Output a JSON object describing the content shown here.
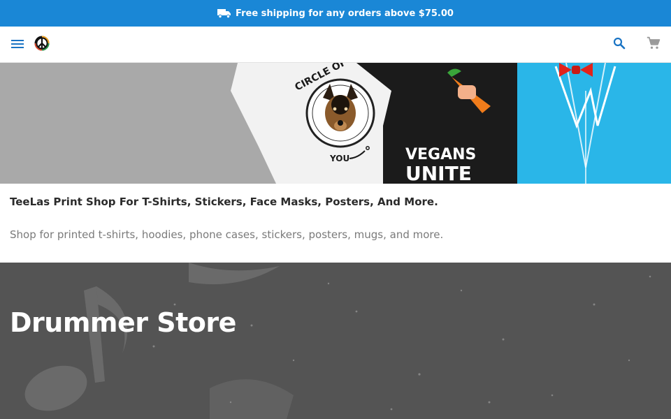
{
  "promo": {
    "text": "Free shipping for any orders above $75.00",
    "icon": "truck-icon"
  },
  "header": {
    "menu_icon": "menu-icon",
    "logo_icon": "peace-sign-logo",
    "search_icon": "search-icon",
    "cart_icon": "cart-icon"
  },
  "hero": {
    "shirt_left_text_top": "CIRCLE OF TRU",
    "shirt_left_text_bottom": "YOU",
    "shirt_middle_line1": "VEGANS",
    "shirt_middle_line2": "UNITE"
  },
  "intro": {
    "title": "TeeLas Print Shop For T-Shirts, Stickers, Face Masks, Posters, And More.",
    "description": "Shop for printed t-shirts, hoodies, phone cases, stickers, posters, mugs, and more."
  },
  "drummer": {
    "title": "Drummer Store"
  },
  "colors": {
    "promo_bg": "#1a87d6",
    "hero_bg": "#a9a9a9",
    "drummer_bg": "#545454",
    "shirt_blue": "#2ab6e8",
    "bowtie_red": "#e2231a"
  }
}
